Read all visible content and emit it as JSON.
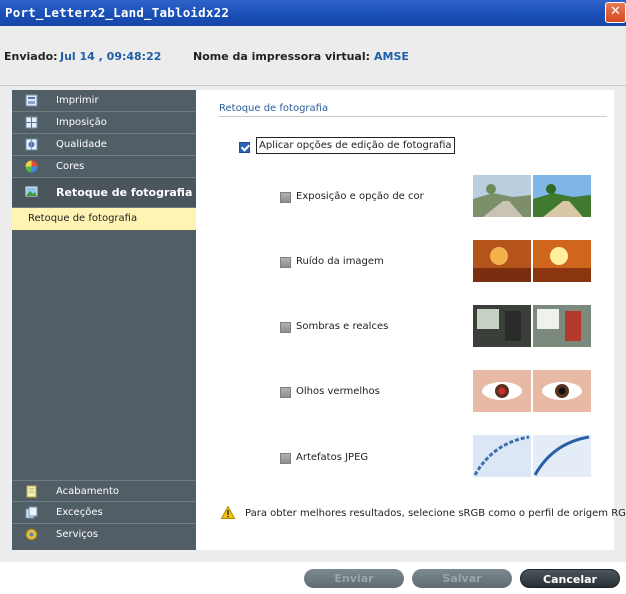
{
  "window": {
    "title": "Port_Letterx2_Land_Tabloidx22",
    "close_glyph": "✕"
  },
  "info": {
    "sent_label": "Enviado:",
    "sent_value": "Jul 14 , 09:48:22",
    "printer_label": "Nome da impressora virtual:",
    "printer_value": "AMSE"
  },
  "sidebar": {
    "items": [
      {
        "label": "Imprimir",
        "icon": "print-icon"
      },
      {
        "label": "Imposição",
        "icon": "imposition-icon"
      },
      {
        "label": "Qualidade",
        "icon": "quality-icon"
      },
      {
        "label": "Cores",
        "icon": "color-wheel-icon"
      },
      {
        "label": "Retoque de fotografia",
        "icon": "photo-retouch-icon",
        "selected": true
      },
      {
        "label": "Acabamento",
        "icon": "finishing-icon"
      },
      {
        "label": "Exceções",
        "icon": "exceptions-icon"
      },
      {
        "label": "Serviços",
        "icon": "services-icon"
      }
    ],
    "sub_item": "Retoque de fotografia"
  },
  "content": {
    "section_title": "Retoque de fotografia",
    "apply_label": "Aplicar opções de edição de fotografia",
    "apply_checked": true,
    "options": [
      {
        "label": "Exposição e opção de cor",
        "checked": false,
        "thumb": "landscape-thumbnail"
      },
      {
        "label": "Ruído da imagem",
        "checked": false,
        "thumb": "sunset-thumbnail"
      },
      {
        "label": "Sombras e realces",
        "checked": false,
        "thumb": "room-thumbnail"
      },
      {
        "label": "Olhos vermelhos",
        "checked": false,
        "thumb": "eyes-thumbnail"
      },
      {
        "label": "Artefatos JPEG",
        "checked": false,
        "thumb": "jpeg-curve-thumbnail"
      }
    ],
    "warning": "Para obter melhores resultados, selecione sRGB como o perfil de origem RGB."
  },
  "buttons": {
    "send": "Enviar",
    "save": "Salvar",
    "cancel": "Cancelar"
  },
  "colors": {
    "titlebar": "#1a4fb8",
    "sidebar": "#525e66",
    "selection": "#fff4b3",
    "accent_text": "#1f5fa8"
  }
}
